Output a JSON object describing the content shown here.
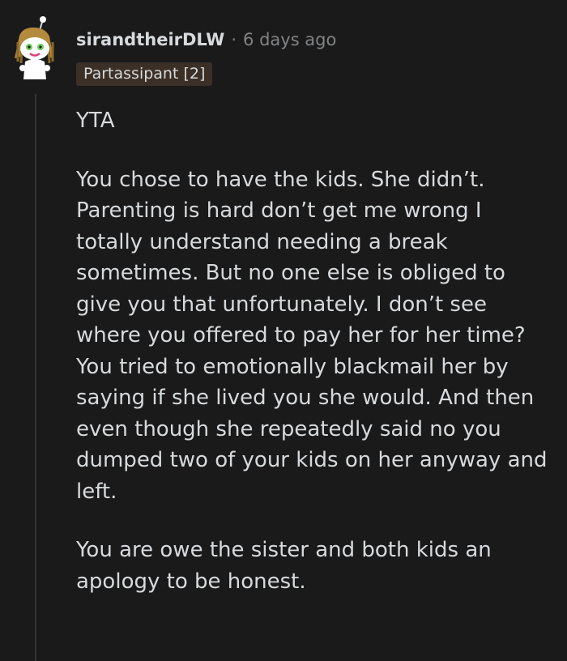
{
  "comment": {
    "author": "sirandtheirDLW",
    "separator": "·",
    "timestamp": "6 days ago",
    "flair": "Partassipant [2]",
    "paragraphs": [
      "YTA",
      "You chose to have the kids. She didn’t. Parenting is hard don’t get me wrong I totally understand needing a break sometimes. But no one else is obliged to give you that unfortunately. I don’t see where you offered to pay her for her time? You tried to emotionally blackmail her by saying if she lived you she would. And then even though she repeatedly said no you dumped two of your kids on her anyway and left.",
      "You are owe the sister and both kids an apology to be honest."
    ]
  },
  "colors": {
    "background": "#1a1a1b",
    "text": "#d7dadc",
    "meta": "#818384",
    "flair_background": "#3b2f26",
    "thread_line": "#343536"
  },
  "icons": {
    "avatar": "snoo-avatar-with-dreadlocks"
  }
}
